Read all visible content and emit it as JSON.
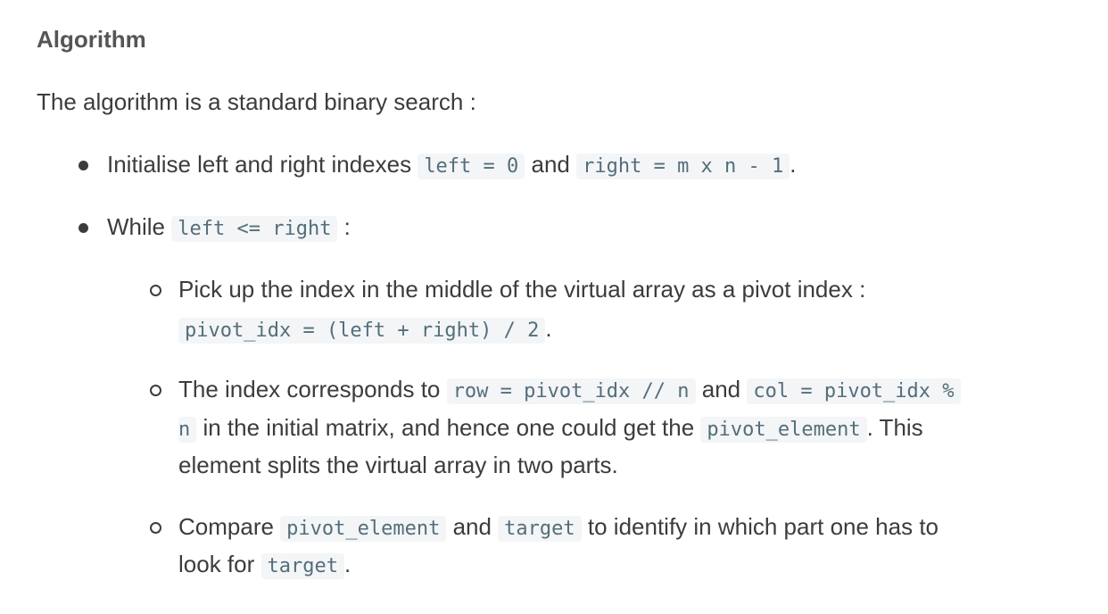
{
  "heading": "Algorithm",
  "intro": "The algorithm is a standard binary search :",
  "bullets": [
    {
      "pre": "Initialise left and right indexes ",
      "code1": "left = 0",
      "mid": " and ",
      "code2": "right = m x n - 1",
      "post": "."
    },
    {
      "pre": "While ",
      "code1": "left <= right",
      "post": " :"
    }
  ],
  "sub_bullets": [
    {
      "line1": "Pick up the index in the middle of the virtual array as a pivot index :",
      "code1": "pivot_idx = (left + right) / 2",
      "post": "."
    },
    {
      "pre": "The index corresponds to ",
      "code1": "row = pivot_idx // n",
      "mid": " and ",
      "code2a": "col = pivot_idx %",
      "code2b": "n",
      "mid2": " in the initial matrix, and hence one could get the ",
      "code3": "pivot_element",
      "post": ". This",
      "line3": "element splits the virtual array in two parts."
    },
    {
      "pre": "Compare ",
      "code1": "pivot_element",
      "mid": " and ",
      "code2": "target",
      "post": " to identify in which part one has to",
      "line2pre": "look for ",
      "code3": "target",
      "line2post": "."
    }
  ]
}
